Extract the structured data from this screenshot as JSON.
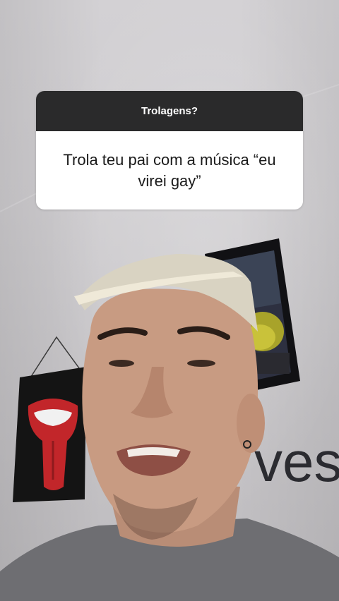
{
  "question": {
    "title": "Trolagens?",
    "answer": "Trola teu pai com a música “eu virei gay”"
  },
  "background": {
    "wall_text": "ves"
  },
  "colors": {
    "header_bg": "#2a2a2b",
    "card_bg": "#ffffff",
    "header_text": "#ffffff",
    "body_text": "#1b1b1b"
  }
}
